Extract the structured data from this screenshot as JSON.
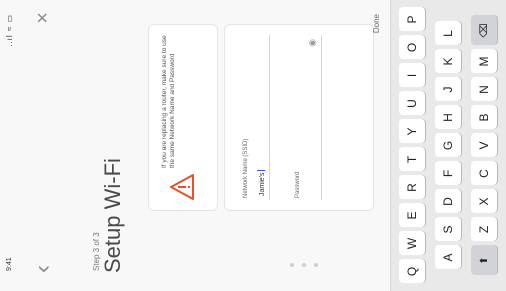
{
  "status_bar": {
    "time": "9:41",
    "icons": "..ıl ≈ ▭"
  },
  "header": {
    "step": "Step 3 of 3",
    "title": "Setup Wi-Fi"
  },
  "warning": {
    "text": "If you are replacing a router, make sure to use the same Network Name and Password"
  },
  "form": {
    "ssid_label": "Network Name (SSID)",
    "ssid_value": "Jamie's",
    "password_label": "Password",
    "password_value": ""
  },
  "done_label": "Done",
  "keyboard": {
    "row1": [
      "Q",
      "W",
      "E",
      "R",
      "T",
      "Y",
      "U",
      "I",
      "O",
      "P"
    ],
    "row2": [
      "A",
      "S",
      "D",
      "F",
      "G",
      "H",
      "J",
      "K",
      "L"
    ],
    "row3": [
      "Z",
      "X",
      "C",
      "V",
      "B",
      "N",
      "M"
    ],
    "shift_glyph": "⬆",
    "delete_glyph": "⌫"
  },
  "icons": [
    "back-icon",
    "close-icon",
    "warning-icon",
    "eye-icon",
    "shift-icon",
    "delete-icon"
  ],
  "colors": {
    "warning": "#e8502a",
    "caret": "#3b5bdb",
    "keyboard_bg": "#e9e9ea"
  }
}
